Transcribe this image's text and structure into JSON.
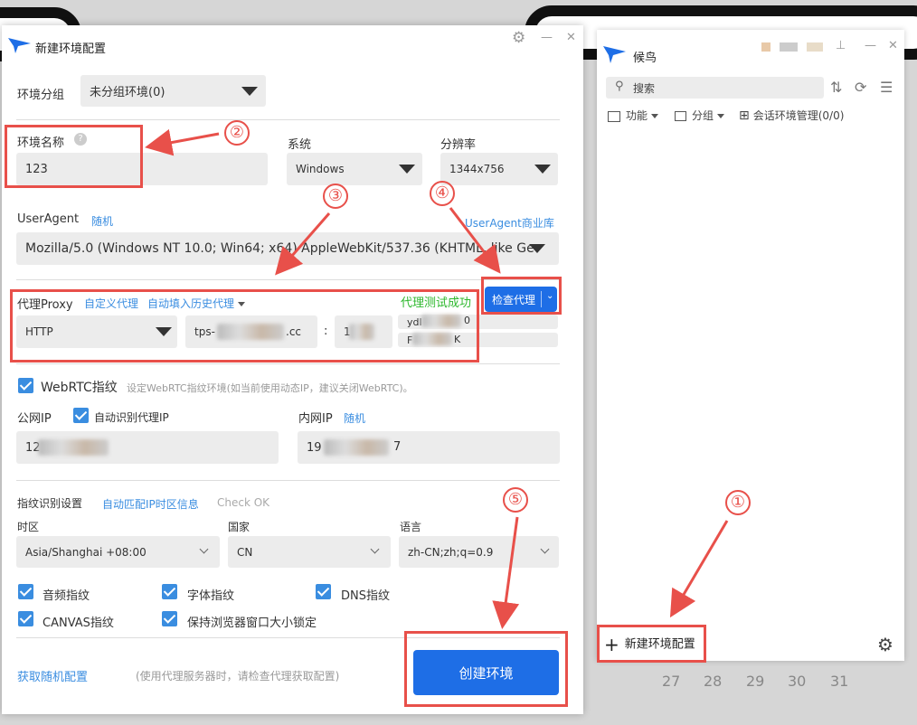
{
  "dialog": {
    "title": "新建环境配置",
    "group_label": "环境分组",
    "group_value": "未分组环境(0)",
    "name_label": "环境名称",
    "name_value": "123",
    "system_label": "系统",
    "system_value": "Windows",
    "resolution_label": "分辨率",
    "resolution_value": "1344x756",
    "ua_label": "UserAgent",
    "ua_random": "随机",
    "ua_library": "UserAgent商业库",
    "ua_value": "Mozilla/5.0 (Windows NT 10.0; Win64; x64) AppleWebKit/537.36 (KHTML, like Ge",
    "proxy_label": "代理Proxy",
    "proxy_custom": "自定义代理",
    "proxy_history": "自动填入历史代理",
    "proxy_success": "代理测试成功",
    "proxy_check_button": "检查代理",
    "proxy_type": "HTTP",
    "proxy_host": "tps-",
    "proxy_host_suffix": ".cc",
    "proxy_colon": ":",
    "proxy_port": "1",
    "proxy_user": "ydl",
    "proxy_user_suffix": "0",
    "proxy_pass": "F",
    "proxy_pass_suffix": "K",
    "webrtc_label": "WebRTC指纹",
    "webrtc_hint": "设定WebRTC指纹环境(如当前使用动态IP，建议关闭WebRTC)。",
    "public_ip_label": "公网IP",
    "auto_ip_label": "自动识别代理IP",
    "public_ip_value": "12",
    "private_ip_label": "内网IP",
    "private_ip_random": "随机",
    "private_ip_value": "19",
    "private_ip_suffix": "7",
    "fp_label": "指纹识别设置",
    "fp_auto": "自动匹配IP时区信息",
    "fp_check": "Check OK",
    "tz_label": "时区",
    "tz_value": "Asia/Shanghai +08:00",
    "country_label": "国家",
    "country_value": "CN",
    "lang_label": "语言",
    "lang_value": "zh-CN;zh;q=0.9",
    "cb_audio": "音频指纹",
    "cb_font": "字体指纹",
    "cb_dns": "DNS指纹",
    "cb_canvas": "CANVAS指纹",
    "cb_window": "保持浏览器窗口大小锁定",
    "random_config": "获取随机配置",
    "footer_hint": "(使用代理服务器时，请检查代理获取配置)",
    "create_button": "创建环境"
  },
  "panel": {
    "title": "候鸟",
    "search_placeholder": "搜索",
    "tool_function": "功能",
    "tool_group": "分组",
    "tool_session": "会话环境管理(0/0)",
    "new_env": "新建环境配置"
  },
  "annotations": [
    "①",
    "②",
    "③",
    "④",
    "⑤"
  ],
  "calendar_days": [
    "27",
    "28",
    "29",
    "30",
    "31"
  ],
  "colors": {
    "accent": "#3a8de0",
    "button": "#1e6ee6",
    "annotation": "#e8504a",
    "success": "#2eb82e"
  }
}
